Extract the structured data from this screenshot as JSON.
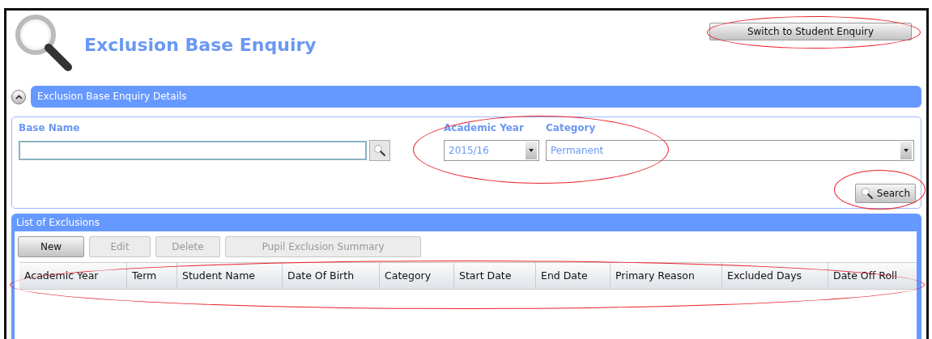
{
  "header": {
    "title": "Exclusion Base Enquiry",
    "switch_button": "Switch to Student Enquiry"
  },
  "details_panel": {
    "title": "Exclusion Base Enquiry Details",
    "expanded": true,
    "fields": [
      {
        "kind": "lookup",
        "label": "Base Name"
      },
      {
        "kind": "dropdown",
        "label": "Academic Year",
        "value": "2015/16"
      },
      {
        "kind": "dropdown",
        "label": "Category",
        "value": "Permanent"
      }
    ],
    "search_button": "Search"
  },
  "list_panel": {
    "title": "List of Exclusions",
    "buttons": [
      {
        "label": "New",
        "disabled": false
      },
      {
        "label": "Edit",
        "disabled": true
      },
      {
        "label": "Delete",
        "disabled": true
      },
      {
        "label": "Pupil Exclusion Summary",
        "disabled": true
      }
    ],
    "table": {
      "columns": [
        "Academic Year",
        "Term",
        "Student Name",
        "Date Of Birth",
        "Category",
        "Start Date",
        "End Date",
        "Primary Reason",
        "Excluded Days",
        "Date Off Roll"
      ]
    }
  }
}
